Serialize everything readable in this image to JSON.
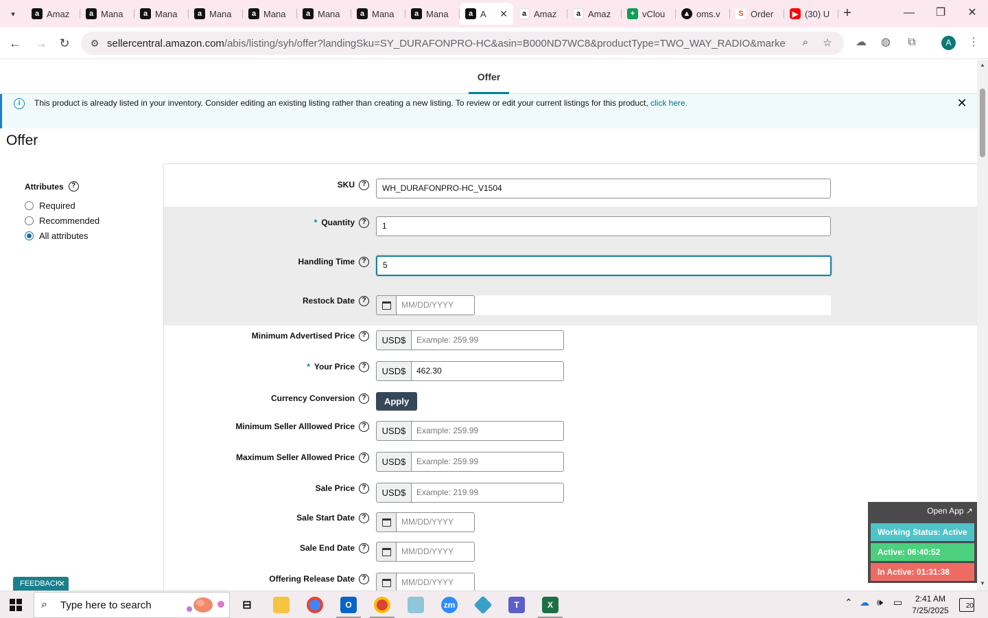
{
  "browser": {
    "tabs": [
      {
        "title": "Amaz",
        "favicon": "amazon-icon"
      },
      {
        "title": "Mana",
        "favicon": "amazon-icon"
      },
      {
        "title": "Mana",
        "favicon": "amazon-icon"
      },
      {
        "title": "Mana",
        "favicon": "amazon-icon"
      },
      {
        "title": "Mana",
        "favicon": "amazon-icon"
      },
      {
        "title": "Mana",
        "favicon": "amazon-icon"
      },
      {
        "title": "Mana",
        "favicon": "amazon-icon"
      },
      {
        "title": "Mana",
        "favicon": "amazon-icon"
      },
      {
        "title": "A",
        "favicon": "amazon-icon",
        "active": true
      },
      {
        "title": "Amaz",
        "favicon": "amazon-smile-icon"
      },
      {
        "title": "Amaz",
        "favicon": "amazon-smile-icon"
      },
      {
        "title": "vClou",
        "favicon": "vcloud-icon"
      },
      {
        "title": "oms.v",
        "favicon": "oms-icon"
      },
      {
        "title": "Order",
        "favicon": "order-icon"
      },
      {
        "title": "(30) U",
        "favicon": "youtube-icon"
      }
    ],
    "url_host": "sellercentral.amazon.com",
    "url_path": "/abis/listing/syh/offer?landingSku=SY_DURAFONPRO-HC&asin=B000ND7WC8&productType=TWO_WAY_RADIO&marketplaceID=AT...",
    "avatar_letter": "A"
  },
  "page": {
    "tab_label": "Offer",
    "alert": {
      "text": "This product is already listed in your inventory. Consider editing an existing listing rather than creating a new listing. To review or edit your current listings for this product, ",
      "link": "click here."
    },
    "title": "Offer",
    "attributes": {
      "heading": "Attributes",
      "options": [
        {
          "label": "Required",
          "checked": false
        },
        {
          "label": "Recommended",
          "checked": false
        },
        {
          "label": "All attributes",
          "checked": true
        }
      ]
    },
    "fields": {
      "sku": {
        "label": "SKU",
        "value": "WH_DURAFONPRO-HC_V1504"
      },
      "quantity": {
        "label": "Quantity",
        "required_mark": "*",
        "value": "1"
      },
      "handling_time": {
        "label": "Handling Time",
        "value": "5"
      },
      "restock_date": {
        "label": "Restock Date",
        "placeholder": "MM/DD/YYYY"
      },
      "min_advertised_price": {
        "label": "Minimum Advertised Price",
        "currency": "USD$",
        "placeholder": "Example: 259.99"
      },
      "your_price": {
        "label": "Your Price",
        "required_mark": "*",
        "currency": "USD$",
        "value": "462.30"
      },
      "currency_conversion": {
        "label": "Currency Conversion",
        "button": "Apply"
      },
      "min_seller_price": {
        "label": "Minimum Seller Alllowed Price",
        "currency": "USD$",
        "placeholder": "Example: 259.99"
      },
      "max_seller_price": {
        "label": "Maximum Seller Allowed Price",
        "currency": "USD$",
        "placeholder": "Example: 259.99"
      },
      "sale_price": {
        "label": "Sale Price",
        "currency": "USD$",
        "placeholder": "Example: 219.99"
      },
      "sale_start_date": {
        "label": "Sale Start Date",
        "placeholder": "MM/DD/YYYY"
      },
      "sale_end_date": {
        "label": "Sale End Date",
        "placeholder": "MM/DD/YYYY"
      },
      "offering_release_date": {
        "label": "Offering Release Date",
        "placeholder": "MM/DD/YYYY"
      }
    },
    "feedback_label": "FEEDBACK"
  },
  "widget": {
    "open_app": "Open App ↗",
    "working_status": "Working Status: Active",
    "active": "Active: 06:40:52",
    "inactive": "In Active: 01:31:38",
    "colors": {
      "working": "#4fc3c8",
      "active": "#4cd07d",
      "inactive": "#ee6b63"
    }
  },
  "taskbar": {
    "search_placeholder": "Type here to search",
    "time": "2:41 AM",
    "date": "7/25/2025",
    "notification_count": "20"
  }
}
